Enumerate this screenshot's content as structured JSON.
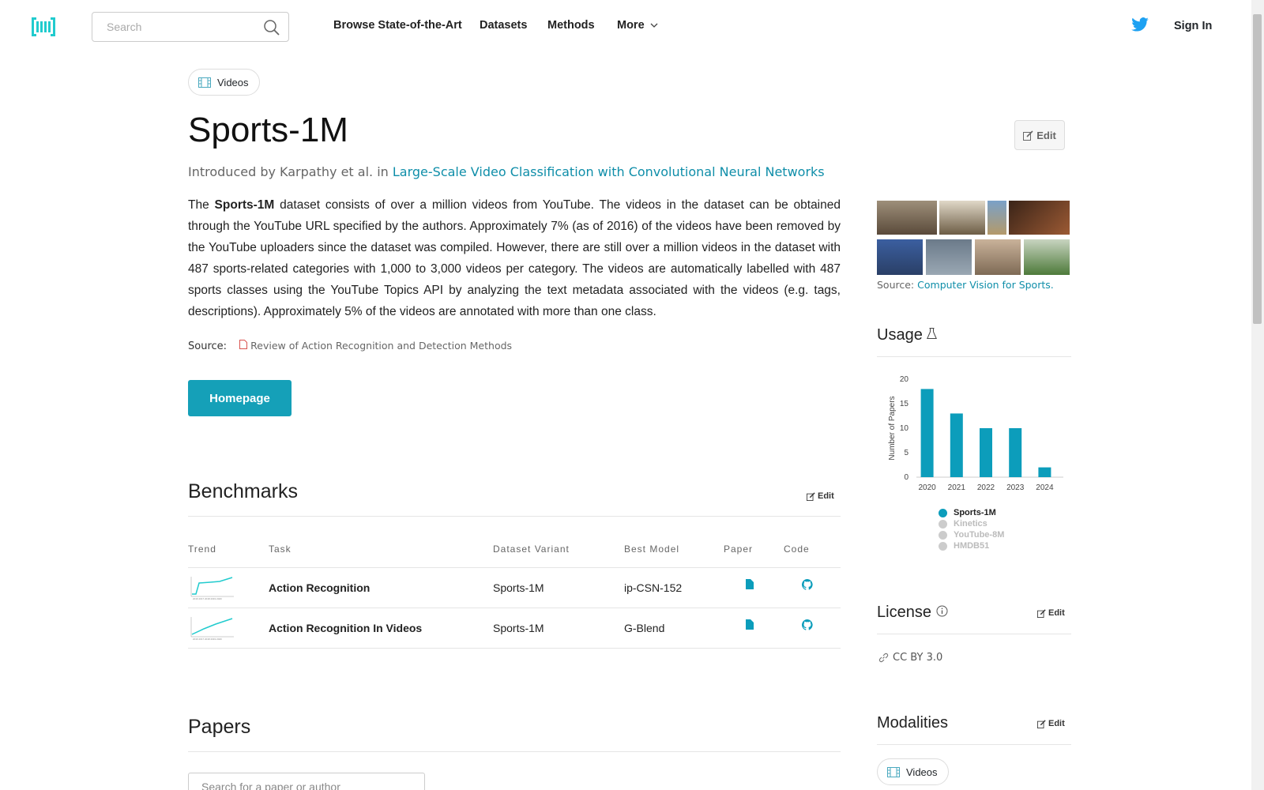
{
  "header": {
    "search_placeholder": "Search",
    "nav": [
      "Browse State-of-the-Art",
      "Datasets",
      "Methods",
      "More"
    ],
    "sign_in": "Sign In"
  },
  "modality_tag": "Videos",
  "dataset": {
    "title": "Sports-1M",
    "edit_label": "Edit",
    "intro_prefix": "Introduced by Karpathy et al. in",
    "intro_paper": "Large-Scale Video Classification with Convolutional Neural Networks",
    "desc_the": "The",
    "desc_name": "Sports-1M",
    "desc_rest": "dataset consists of over a million videos from YouTube. The videos in the dataset can be obtained through the YouTube URL specified by the authors. Approximately 7% (as of 2016) of the videos have been removed by the YouTube uploaders since the dataset was compiled. However, there are still over a million videos in the dataset with 487 sports-related categories with 1,000 to 3,000 videos per category. The videos are automatically labelled with 487 sports classes using the YouTube Topics API by analyzing the text metadata associated with the videos (e.g. tags, descriptions). Approximately 5% of the videos are annotated with more than one class.",
    "source_label": "Source:",
    "source_link": "Review of Action Recognition and Detection Methods",
    "homepage_label": "Homepage"
  },
  "benchmarks": {
    "title": "Benchmarks",
    "edit_label": "Edit",
    "columns": [
      "Trend",
      "Task",
      "Dataset Variant",
      "Best Model",
      "Paper",
      "Code"
    ],
    "rows": [
      {
        "task": "Action Recognition",
        "variant": "Sports-1M",
        "model": "ip-CSN-152"
      },
      {
        "task": "Action Recognition In Videos",
        "variant": "Sports-1M",
        "model": "G-Blend"
      }
    ]
  },
  "papers": {
    "title": "Papers",
    "search_placeholder": "Search for a paper or author"
  },
  "sidebar": {
    "image_source_label": "Source:",
    "image_source_link": "Computer Vision for Sports.",
    "usage_title": "Usage",
    "license_title": "License",
    "license_edit": "Edit",
    "license_value": "CC BY 3.0",
    "modalities_title": "Modalities",
    "modalities_edit": "Edit",
    "modality": "Videos"
  },
  "chart_data": {
    "type": "bar",
    "categories": [
      "2020",
      "2021",
      "2022",
      "2023",
      "2024"
    ],
    "series": [
      {
        "name": "Sports-1M",
        "values": [
          18,
          13,
          10,
          10,
          2
        ]
      }
    ],
    "ylabel": "Number of Papers",
    "yticks": [
      "0",
      "5",
      "10",
      "15",
      "20"
    ],
    "ylim": [
      0,
      20
    ],
    "legend": [
      "Sports-1M",
      "Kinetics",
      "YouTube-8M",
      "HMDB51"
    ],
    "colors": {
      "active": "#0c9dbb",
      "inactive": "#cccccc"
    }
  },
  "colors": {
    "accent": "#15a0b8",
    "link": "#0f8ea9"
  }
}
